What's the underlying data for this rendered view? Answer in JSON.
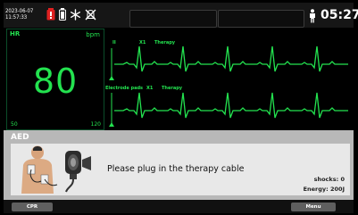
{
  "status_bar": {
    "date": "2023-06-07",
    "time_small": "11:57:33",
    "clock": "05:27",
    "icons": [
      "battery-alert-icon",
      "battery-icon",
      "snowflake-icon",
      "alarm-off-icon",
      "person-icon"
    ]
  },
  "hr": {
    "label": "HR",
    "unit": "bpm",
    "value": "80",
    "alarm_low": "50",
    "alarm_high": "120",
    "color": "#23e24f"
  },
  "waves": [
    {
      "lead": "II",
      "gain": "X1",
      "filter": "Therapy"
    },
    {
      "lead": "Electrode pads",
      "gain": "X1",
      "filter": "Therapy"
    }
  ],
  "aed": {
    "title": "AED",
    "message": "Please plug in the therapy cable",
    "shocks": "shocks: 0",
    "energy": "Energy: 200J"
  },
  "softkeys": {
    "cpr": "CPR",
    "menu": "Menu"
  }
}
